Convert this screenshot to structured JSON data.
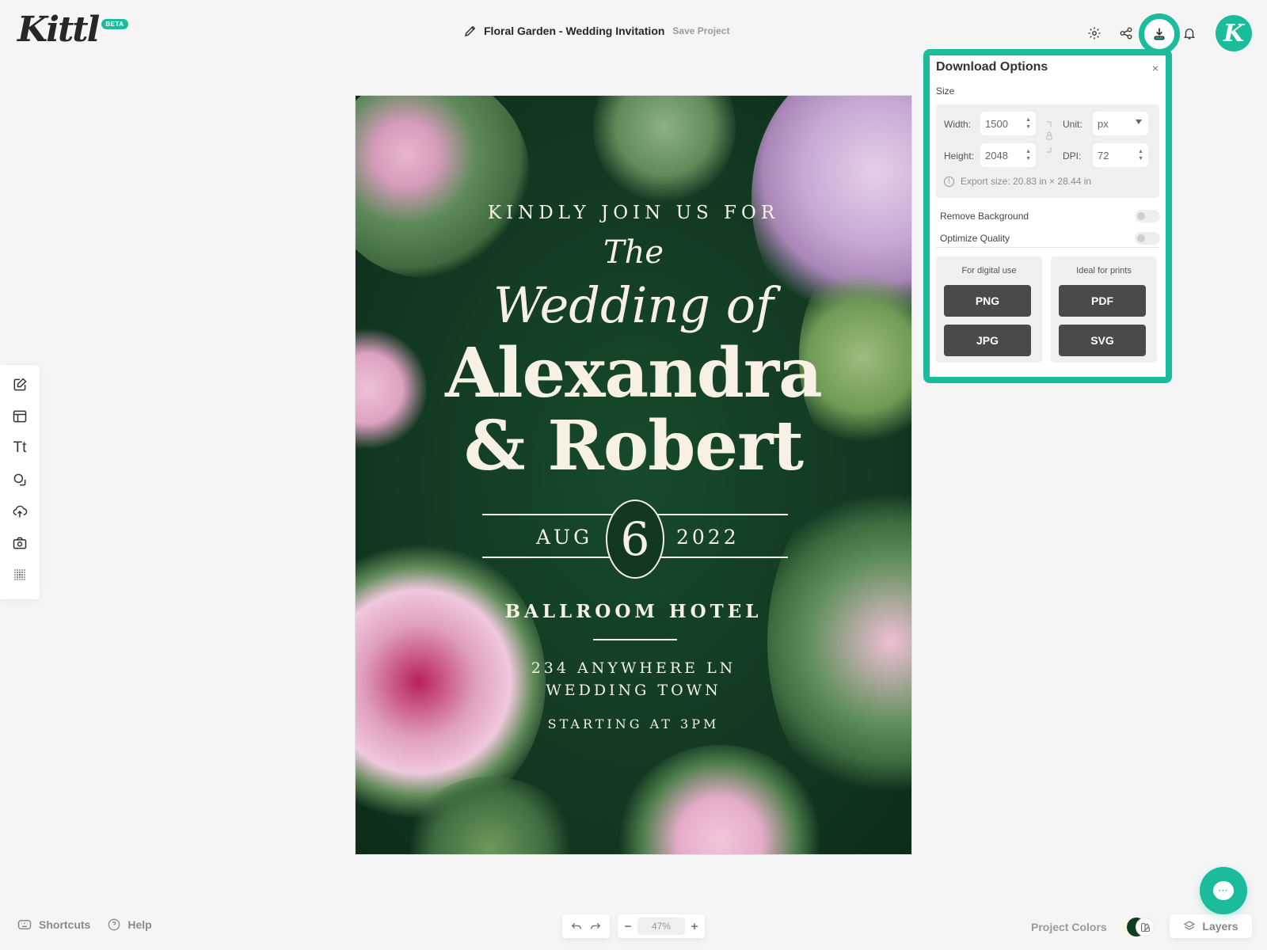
{
  "app": {
    "logo": "Kittl",
    "badge": "BETA"
  },
  "header": {
    "project_title": "Floral Garden - Wedding Invitation",
    "save_label": "Save Project",
    "icons": [
      "gear-icon",
      "share-icon",
      "download-icon",
      "bell-icon"
    ],
    "avatar_initial": "K"
  },
  "left_toolbar": {
    "items": [
      "edit-icon",
      "templates-icon",
      "text-icon",
      "shapes-icon",
      "upload-icon",
      "camera-icon",
      "pattern-icon"
    ],
    "text_glyph": "Tt"
  },
  "canvas": {
    "kindly": "KINDLY JOIN US FOR",
    "the": "The",
    "wedding_of": "Wedding of",
    "name1": "Alexandra",
    "name2": "& Robert",
    "month": "AUG",
    "day": "6",
    "year": "2022",
    "venue": "BALLROOM HOTEL",
    "address1": "234 ANYWHERE LN",
    "address2": "WEDDING TOWN",
    "time": "STARTING AT 3PM"
  },
  "download_panel": {
    "title": "Download Options",
    "close": "×",
    "size_label": "Size",
    "width_label": "Width:",
    "width_value": "1500",
    "height_label": "Height:",
    "height_value": "2048",
    "unit_label": "Unit:",
    "unit_value": "px",
    "dpi_label": "DPI:",
    "dpi_value": "72",
    "export_size": "Export size: 20.83 in × 28.44 in",
    "remove_bg_label": "Remove Background",
    "remove_bg_on": false,
    "optimize_label": "Optimize Quality",
    "optimize_on": false,
    "digital_caption": "For digital use",
    "print_caption": "Ideal for prints",
    "formats": {
      "png": "PNG",
      "jpg": "JPG",
      "pdf": "PDF",
      "svg": "SVG"
    }
  },
  "bottom": {
    "shortcuts": "Shortcuts",
    "help": "Help",
    "zoom": "47%",
    "zoom_minus": "−",
    "zoom_plus": "+",
    "project_colors": "Project Colors",
    "layers": "Layers",
    "colors": [
      "#faf5e6",
      "#0f3d24"
    ]
  },
  "colors": {
    "accent": "#1abc9c",
    "canvas_bg": "#12381f",
    "button_dark": "#4a4a4a"
  }
}
